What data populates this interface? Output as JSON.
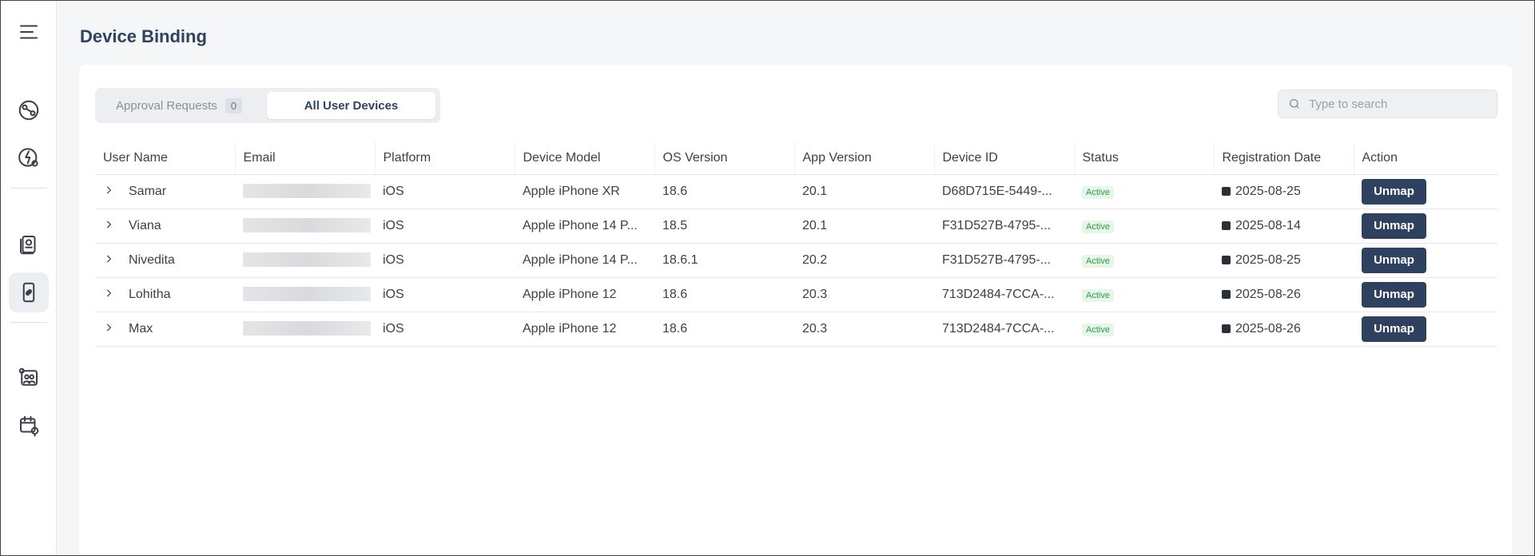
{
  "page": {
    "title": "Device Binding"
  },
  "tabs": {
    "approval_label": "Approval Requests",
    "approval_count": "0",
    "all_devices_label": "All User Devices"
  },
  "search": {
    "placeholder": "Type to search"
  },
  "table": {
    "headers": [
      "User Name",
      "Email",
      "Platform",
      "Device Model",
      "OS Version",
      "App Version",
      "Device ID",
      "Status",
      "Registration Date",
      "Action"
    ],
    "rows": [
      {
        "user": "Samar",
        "platform": "iOS",
        "model": "Apple iPhone XR",
        "os": "18.6",
        "app": "20.1",
        "device_id": "D68D715E-5449-...",
        "status": "Active",
        "date": "2025-08-25",
        "action": "Unmap"
      },
      {
        "user": "Viana",
        "platform": "iOS",
        "model": "Apple iPhone 14 P...",
        "os": "18.5",
        "app": "20.1",
        "device_id": "F31D527B-4795-...",
        "status": "Active",
        "date": "2025-08-14",
        "action": "Unmap"
      },
      {
        "user": "Nivedita",
        "platform": "iOS",
        "model": "Apple iPhone 14 P...",
        "os": "18.6.1",
        "app": "20.2",
        "device_id": "F31D527B-4795-...",
        "status": "Active",
        "date": "2025-08-25",
        "action": "Unmap"
      },
      {
        "user": "Lohitha",
        "platform": "iOS",
        "model": "Apple iPhone 12",
        "os": "18.6",
        "app": "20.3",
        "device_id": "713D2484-7CCA-...",
        "status": "Active",
        "date": "2025-08-26",
        "action": "Unmap"
      },
      {
        "user": "Max",
        "platform": "iOS",
        "model": "Apple iPhone 12",
        "os": "18.6",
        "app": "20.3",
        "device_id": "713D2484-7CCA-...",
        "status": "Active",
        "date": "2025-08-26",
        "action": "Unmap"
      }
    ]
  },
  "sidebar": {
    "icons": [
      "menu-icon",
      "map-route-icon",
      "flash-location-icon",
      "report-icon",
      "device-binding-icon",
      "users-location-icon",
      "calendar-location-icon"
    ]
  },
  "colors": {
    "primary": "#2e4260",
    "status_active": "#2d9a46"
  }
}
